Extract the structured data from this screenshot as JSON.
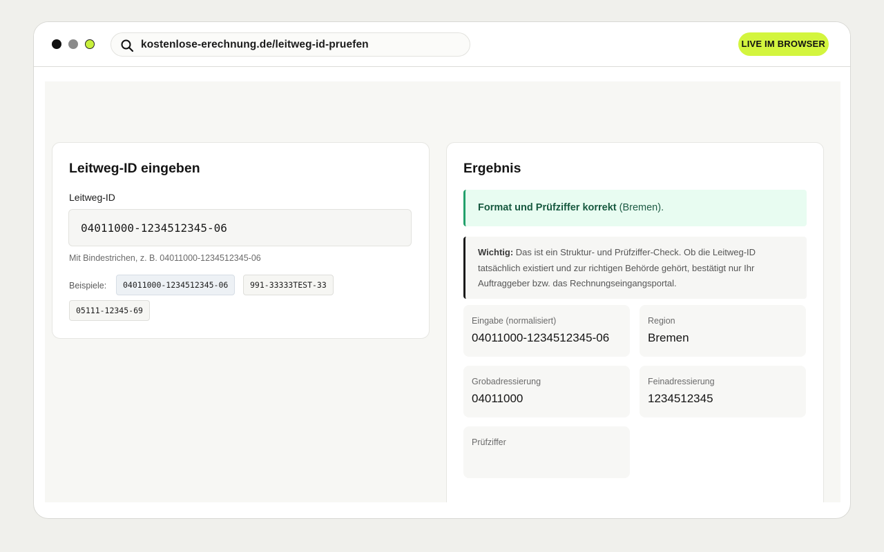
{
  "browser": {
    "url": "kostenlose-erechnung.de/leitweg-id-pruefen",
    "badge": "LIVE IM BROWSER",
    "accent_color": "#d3f53e"
  },
  "input_card": {
    "title": "Leitweg-ID eingeben",
    "field_label": "Leitweg-ID",
    "field_value": "04011000-1234512345-06",
    "hint": "Mit Bindestrichen, z. B. 04011000-1234512345-06",
    "examples_label": "Beispiele:",
    "examples": [
      "04011000-1234512345-06",
      "991-33333TEST-33",
      "05111-12345-69"
    ]
  },
  "result_card": {
    "title": "Ergebnis",
    "success_bold": "Format und Prüfziffer korrekt",
    "success_rest": " (Bremen).",
    "success_color": "#22a06b",
    "warning_bold": "Wichtig:",
    "warning_text": " Das ist ein Struktur- und Prüfziffer-Check. Ob die Leitweg-ID tatsächlich existiert und zur richtigen Behörde gehört, bestätigt nur Ihr Auftraggeber bzw. das Rechnungseingangsportal.",
    "stats": [
      {
        "label": "Eingabe (normalisiert)",
        "value": "04011000-1234512345-06"
      },
      {
        "label": "Region",
        "value": "Bremen"
      },
      {
        "label": "Grobadressierung",
        "value": "04011000"
      },
      {
        "label": "Feinadressierung",
        "value": "1234512345"
      },
      {
        "label": "Prüfziffer",
        "value": ""
      }
    ]
  }
}
